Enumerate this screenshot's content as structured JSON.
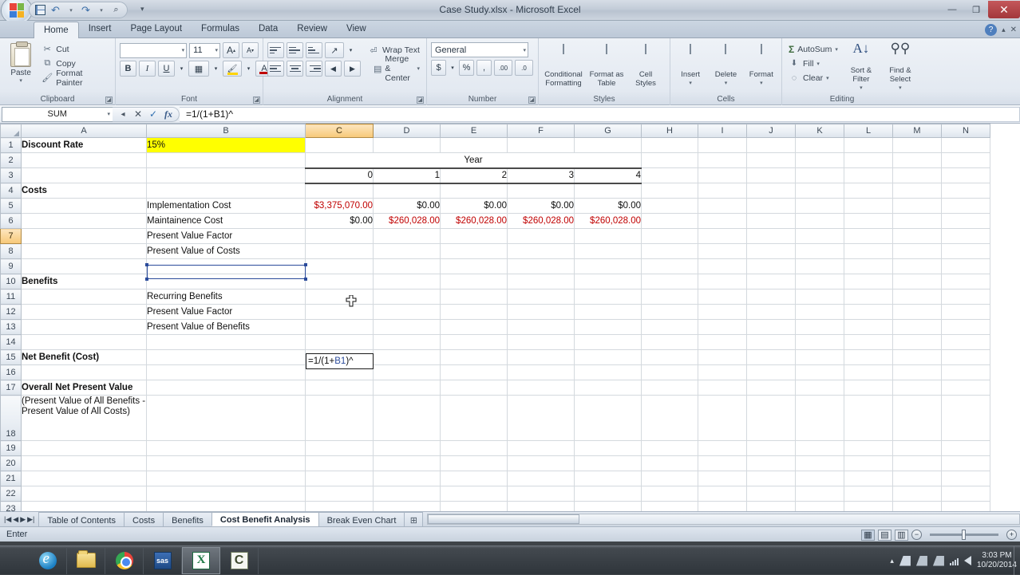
{
  "window": {
    "title": "Case Study.xlsx - Microsoft Excel",
    "minimize": "—",
    "restore": "❐",
    "close": "✕"
  },
  "quick_access": {
    "save": "save-icon",
    "undo": "↶",
    "undo_caret": "▾",
    "redo": "↷",
    "redo_caret": "▾",
    "print_preview": "⌕",
    "customize": "▾"
  },
  "ribbon": {
    "tabs": [
      {
        "label": "Home",
        "active": true
      },
      {
        "label": "Insert",
        "active": false
      },
      {
        "label": "Page Layout",
        "active": false
      },
      {
        "label": "Formulas",
        "active": false
      },
      {
        "label": "Data",
        "active": false
      },
      {
        "label": "Review",
        "active": false
      },
      {
        "label": "View",
        "active": false
      }
    ],
    "help": "?",
    "minimize_ribbon": "▴",
    "close_window": "✕",
    "groups": {
      "clipboard": {
        "label": "Clipboard",
        "paste": "Paste",
        "paste_caret": "▾",
        "cut": "Cut",
        "copy": "Copy",
        "format_painter": "Format Painter"
      },
      "font": {
        "label": "Font",
        "font_name": "",
        "font_size": "11",
        "grow_font": "A",
        "shrink_font": "A",
        "bold": "B",
        "italic": "I",
        "underline": "U",
        "borders": "▦",
        "fill_color": "A",
        "font_color": "A",
        "caret": "▾"
      },
      "alignment": {
        "label": "Alignment",
        "wrap_text": "Wrap Text",
        "merge_center": "Merge & Center",
        "orientation": "↗",
        "indent_decrease": "◀",
        "indent_increase": "▶"
      },
      "number": {
        "label": "Number",
        "format": "General",
        "currency": "$",
        "percent": "%",
        "comma": ",",
        "increase_decimal": ".00",
        "decrease_decimal": ".0"
      },
      "styles": {
        "label": "Styles",
        "conditional_formatting": "Conditional Formatting",
        "format_as_table": "Format as Table",
        "cell_styles": "Cell Styles",
        "caret": "▾"
      },
      "cells": {
        "label": "Cells",
        "insert": "Insert",
        "delete": "Delete",
        "format": "Format",
        "caret": "▾"
      },
      "editing": {
        "label": "Editing",
        "autosum": "AutoSum",
        "fill": "Fill",
        "clear": "Clear",
        "sort_filter": "Sort & Filter",
        "find_select": "Find & Select",
        "caret": "▾"
      }
    }
  },
  "formula_bar": {
    "name_box": "SUM",
    "name_box_caret": "▾",
    "cancel": "✕",
    "enter": "✓",
    "insert_function": "fx",
    "value": "=1/(1+B1)^"
  },
  "sheet": {
    "columns": [
      "A",
      "B",
      "C",
      "D",
      "E",
      "F",
      "G",
      "H",
      "I",
      "J",
      "K",
      "L",
      "M",
      "N"
    ],
    "selected_column": "C",
    "selected_row": 7,
    "rows": [
      1,
      2,
      3,
      4,
      5,
      6,
      7,
      8,
      9,
      10,
      11,
      12,
      13,
      14,
      15,
      16,
      17,
      18,
      19,
      20,
      21,
      22,
      23
    ],
    "cells": {
      "A1": "Discount Rate",
      "B1": "15%",
      "E2": "Year",
      "C3": "0",
      "D3": "1",
      "E3": "2",
      "F3": "3",
      "G3": "4",
      "A4": "Costs",
      "B5": "Implementation Cost",
      "C5": "$3,375,070.00",
      "D5": "$0.00",
      "E5": "$0.00",
      "F5": "$0.00",
      "G5": "$0.00",
      "B6": "Maintainence Cost",
      "C6": "$0.00",
      "D6": "$260,028.00",
      "E6": "$260,028.00",
      "F6": "$260,028.00",
      "G6": "$260,028.00",
      "B7": "Present Value Factor",
      "C7_editing": "=1/(1+B1)^",
      "C7_prefix": "=1/(1+",
      "C7_ref": "B1",
      "C7_suffix": ")^",
      "B8": "Present Value of Costs",
      "A10": "Benefits",
      "B11": "Recurring Benefits",
      "B12": "Present Value Factor",
      "B13": "Present Value of Benefits",
      "A15": "Net Benefit (Cost)",
      "A17": "Overall Net Present Value",
      "A18": "(Present Value of All Benefits - Present Value of All Costs)"
    }
  },
  "sheet_tabs": {
    "nav_first": "|◀",
    "nav_prev": "◀",
    "nav_next": "▶",
    "nav_last": "▶|",
    "tabs": [
      {
        "label": "Table of Contents",
        "active": false
      },
      {
        "label": "Costs",
        "active": false
      },
      {
        "label": "Benefits",
        "active": false
      },
      {
        "label": "Cost Benefit Analysis",
        "active": true
      },
      {
        "label": "Break Even Chart",
        "active": false
      }
    ],
    "new_sheet": "⊞"
  },
  "status_bar": {
    "mode": "Enter",
    "view_normal": "▦",
    "view_page_layout": "▤",
    "view_page_break": "▥",
    "zoom_out": "−",
    "zoom_in": "+"
  },
  "taskbar": {
    "items": [
      {
        "name": "internet-explorer",
        "label": "e"
      },
      {
        "name": "file-explorer",
        "label": ""
      },
      {
        "name": "google-chrome",
        "label": ""
      },
      {
        "name": "sas",
        "label": "sas"
      },
      {
        "name": "microsoft-excel",
        "label": "X",
        "active": true
      },
      {
        "name": "camtasia",
        "label": "C",
        "active": false
      }
    ],
    "tray": {
      "show_hidden": "▴",
      "time": "3:03 PM",
      "date": "10/20/2014"
    }
  },
  "colors": {
    "accent": "#2b4b9b",
    "negative": "#c00000",
    "highlight": "#ffff00",
    "tab_active": "#eef2f7"
  }
}
